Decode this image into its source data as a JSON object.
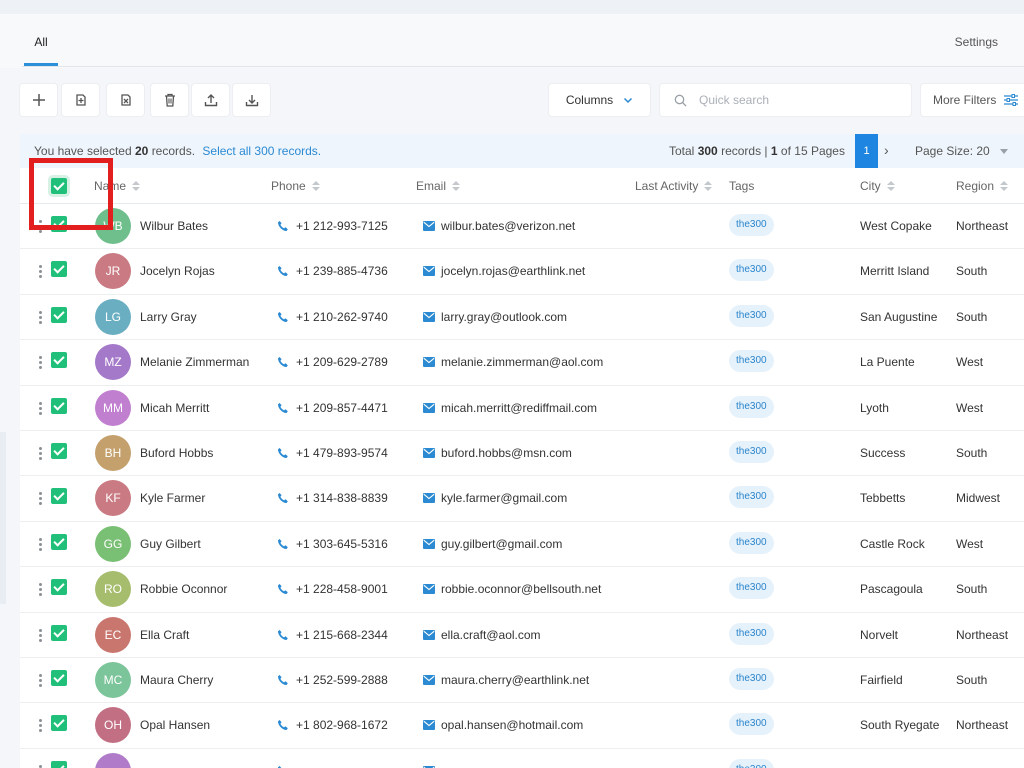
{
  "tabs": {
    "all": "All",
    "settings": "Settings"
  },
  "toolbar": {
    "icons": [
      "plus-icon",
      "assign-icon",
      "unassign-icon",
      "trash-icon",
      "upload-icon",
      "download-icon"
    ],
    "columns_label": "Columns",
    "search_placeholder": "Quick search",
    "more_filters_label": "More Filters"
  },
  "selection": {
    "prefix": "You have selected",
    "count": "20",
    "suffix": "records.",
    "select_all": "Select all 300 records."
  },
  "pagination": {
    "total_prefix": "Total",
    "total": "300",
    "records_sep": "records |",
    "current": "1",
    "of_text": "of 15 Pages",
    "page_button": "1",
    "next": "›",
    "page_size": "Page Size: 20"
  },
  "columns": {
    "name": "Name",
    "phone": "Phone",
    "email": "Email",
    "last_activity": "Last Activity",
    "tags": "Tags",
    "city": "City",
    "region": "Region"
  },
  "rows": [
    {
      "initials": "WB",
      "color": "#6fbf8c",
      "name": "Wilbur Bates",
      "phone": "+1 212-993-7125",
      "email": "wilbur.bates@verizon.net",
      "tag": "the300",
      "city": "West Copake",
      "region": "Northeast"
    },
    {
      "initials": "JR",
      "color": "#c97a82",
      "name": "Jocelyn Rojas",
      "phone": "+1 239-885-4736",
      "email": "jocelyn.rojas@earthlink.net",
      "tag": "the300",
      "city": "Merritt Island",
      "region": "South"
    },
    {
      "initials": "LG",
      "color": "#6aaec2",
      "name": "Larry Gray",
      "phone": "+1 210-262-9740",
      "email": "larry.gray@outlook.com",
      "tag": "the300",
      "city": "San Augustine",
      "region": "South"
    },
    {
      "initials": "MZ",
      "color": "#a579c9",
      "name": "Melanie Zimmerman",
      "phone": "+1 209-629-2789",
      "email": "melanie.zimmerman@aol.com",
      "tag": "the300",
      "city": "La Puente",
      "region": "West"
    },
    {
      "initials": "MM",
      "color": "#c07fcf",
      "name": "Micah Merritt",
      "phone": "+1 209-857-4471",
      "email": "micah.merritt@rediffmail.com",
      "tag": "the300",
      "city": "Lyoth",
      "region": "West"
    },
    {
      "initials": "BH",
      "color": "#c4a06c",
      "name": "Buford Hobbs",
      "phone": "+1 479-893-9574",
      "email": "buford.hobbs@msn.com",
      "tag": "the300",
      "city": "Success",
      "region": "South"
    },
    {
      "initials": "KF",
      "color": "#c97a82",
      "name": "Kyle Farmer",
      "phone": "+1 314-838-8839",
      "email": "kyle.farmer@gmail.com",
      "tag": "the300",
      "city": "Tebbetts",
      "region": "Midwest"
    },
    {
      "initials": "GG",
      "color": "#79bf74",
      "name": "Guy Gilbert",
      "phone": "+1 303-645-5316",
      "email": "guy.gilbert@gmail.com",
      "tag": "the300",
      "city": "Castle Rock",
      "region": "West"
    },
    {
      "initials": "RO",
      "color": "#a7bd6e",
      "name": "Robbie Oconnor",
      "phone": "+1 228-458-9001",
      "email": "robbie.oconnor@bellsouth.net",
      "tag": "the300",
      "city": "Pascagoula",
      "region": "South"
    },
    {
      "initials": "EC",
      "color": "#c9776e",
      "name": "Ella Craft",
      "phone": "+1 215-668-2344",
      "email": "ella.craft@aol.com",
      "tag": "the300",
      "city": "Norvelt",
      "region": "Northeast"
    },
    {
      "initials": "MC",
      "color": "#7cc49a",
      "name": "Maura Cherry",
      "phone": "+1 252-599-2888",
      "email": "maura.cherry@earthlink.net",
      "tag": "the300",
      "city": "Fairfield",
      "region": "South"
    },
    {
      "initials": "OH",
      "color": "#c26f84",
      "name": "Opal Hansen",
      "phone": "+1 802-968-1672",
      "email": "opal.hansen@hotmail.com",
      "tag": "the300",
      "city": "South Ryegate",
      "region": "Northeast"
    },
    {
      "initials": "",
      "color": "#b07cc9",
      "name": "",
      "phone": "",
      "email": "",
      "tag": "the300",
      "city": "",
      "region": ""
    }
  ]
}
